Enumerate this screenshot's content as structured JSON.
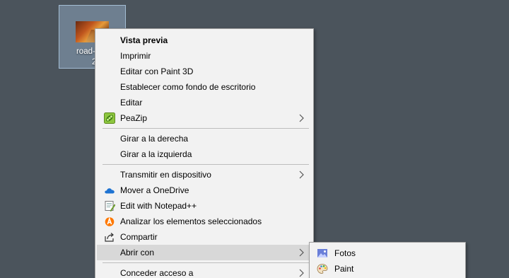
{
  "desktop": {
    "background_color": "#4b545c",
    "file_icon": {
      "label_line1": "road-107",
      "label_line2": "20",
      "icon": "image-thumbnail-icon"
    }
  },
  "context_menu": {
    "items": [
      {
        "label": "Vista previa",
        "bold": true
      },
      {
        "label": "Imprimir"
      },
      {
        "label": "Editar con Paint 3D"
      },
      {
        "label": "Establecer como fondo de escritorio"
      },
      {
        "label": "Editar"
      },
      {
        "label": "PeaZip",
        "icon": "peazip-icon",
        "submenu": true
      },
      {
        "label": "Girar a la derecha"
      },
      {
        "label": "Girar a la izquierda"
      },
      {
        "label": "Transmitir en dispositivo",
        "submenu": true
      },
      {
        "label": "Mover a OneDrive",
        "icon": "onedrive-cloud-icon"
      },
      {
        "label": "Edit with Notepad++",
        "icon": "notepad-plus-plus-icon"
      },
      {
        "label": "Analizar los elementos seleccionados",
        "icon": "avast-icon"
      },
      {
        "label": "Compartir",
        "icon": "share-icon"
      },
      {
        "label": "Abrir con",
        "submenu": true,
        "highlighted": true
      },
      {
        "label": "Conceder acceso a",
        "submenu": true
      }
    ]
  },
  "open_with_submenu": {
    "items": [
      {
        "label": "Fotos",
        "icon": "photos-icon"
      },
      {
        "label": "Paint",
        "icon": "paint-palette-icon"
      }
    ]
  },
  "colors": {
    "menu_bg": "#f2f2f2",
    "highlight": "#d8d8d8",
    "separator": "#bdbdbd"
  }
}
